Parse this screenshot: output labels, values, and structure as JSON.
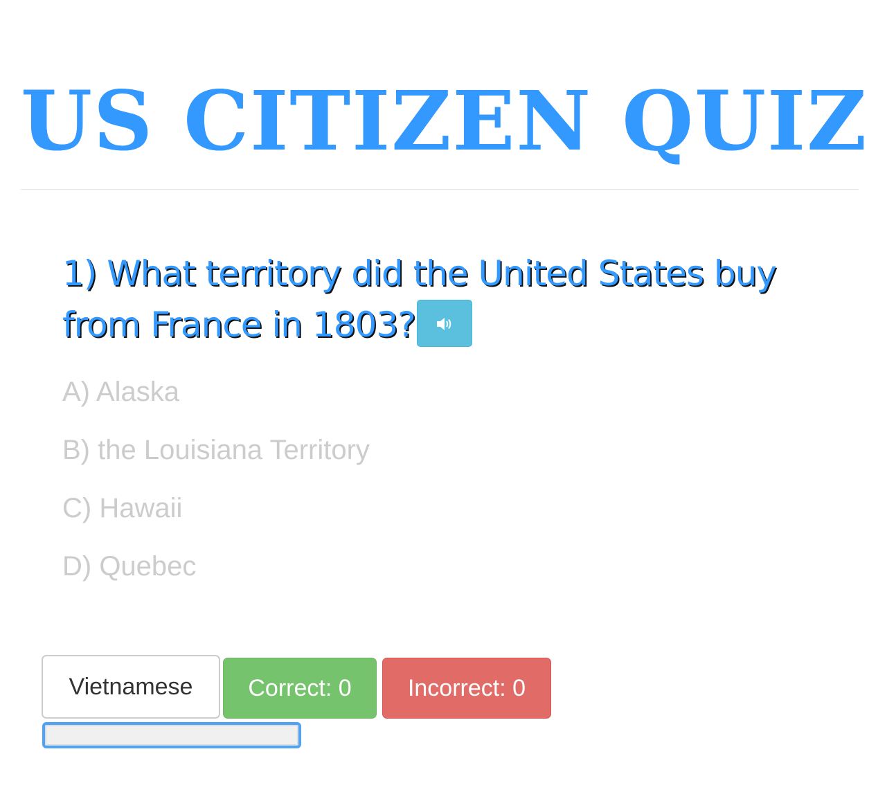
{
  "header": {
    "title": "US CITIZEN QUIZ"
  },
  "question": {
    "text": "1) What territory did the United States buy from France in 1803?"
  },
  "answers": [
    "A) Alaska",
    "B) the Louisiana Territory",
    "C) Hawaii",
    "D) Quebec"
  ],
  "controls": {
    "language_label": "Vietnamese",
    "correct_label": "Correct: 0",
    "incorrect_label": "Incorrect: 0"
  },
  "colors": {
    "accent": "#3399ff",
    "speaker_button": "#5bc0de",
    "correct": "#76c36e",
    "incorrect": "#e06b67",
    "answer_text": "#cccccc"
  },
  "icons": {
    "speaker": "volume-up-icon"
  }
}
